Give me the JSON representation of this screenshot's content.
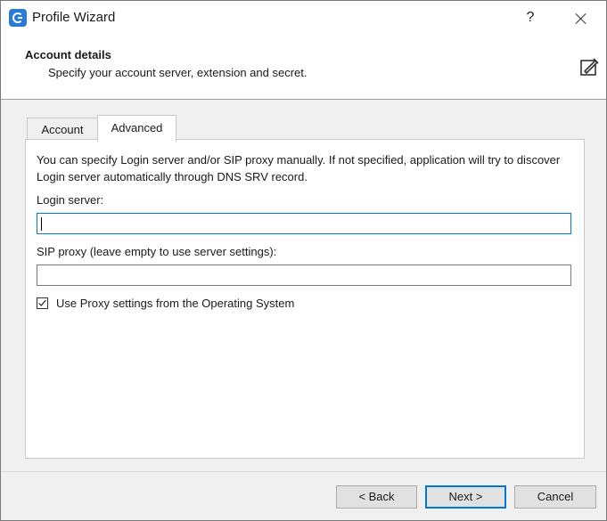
{
  "window": {
    "title": "Profile Wizard",
    "help_label": "?"
  },
  "header": {
    "title": "Account details",
    "subtitle": "Specify your account server, extension and secret.",
    "icon": "edit-icon"
  },
  "tabs": [
    {
      "label": "Account",
      "active": false
    },
    {
      "label": "Advanced",
      "active": true
    }
  ],
  "advanced": {
    "intro": "You can specify Login server and/or SIP proxy manually. If not specified, application will try to discover Login server automatically through DNS SRV record.",
    "login_label": "Login server:",
    "login_value": "",
    "proxy_label": "SIP proxy (leave empty to use server settings):",
    "proxy_value": "",
    "use_os_proxy_label": "Use Proxy settings from the Operating System",
    "use_os_proxy_checked": true
  },
  "buttons": {
    "back": "< Back",
    "next": "Next >",
    "cancel": "Cancel"
  },
  "colors": {
    "accent": "#0078d7",
    "app_icon": "#2a7ad8"
  }
}
